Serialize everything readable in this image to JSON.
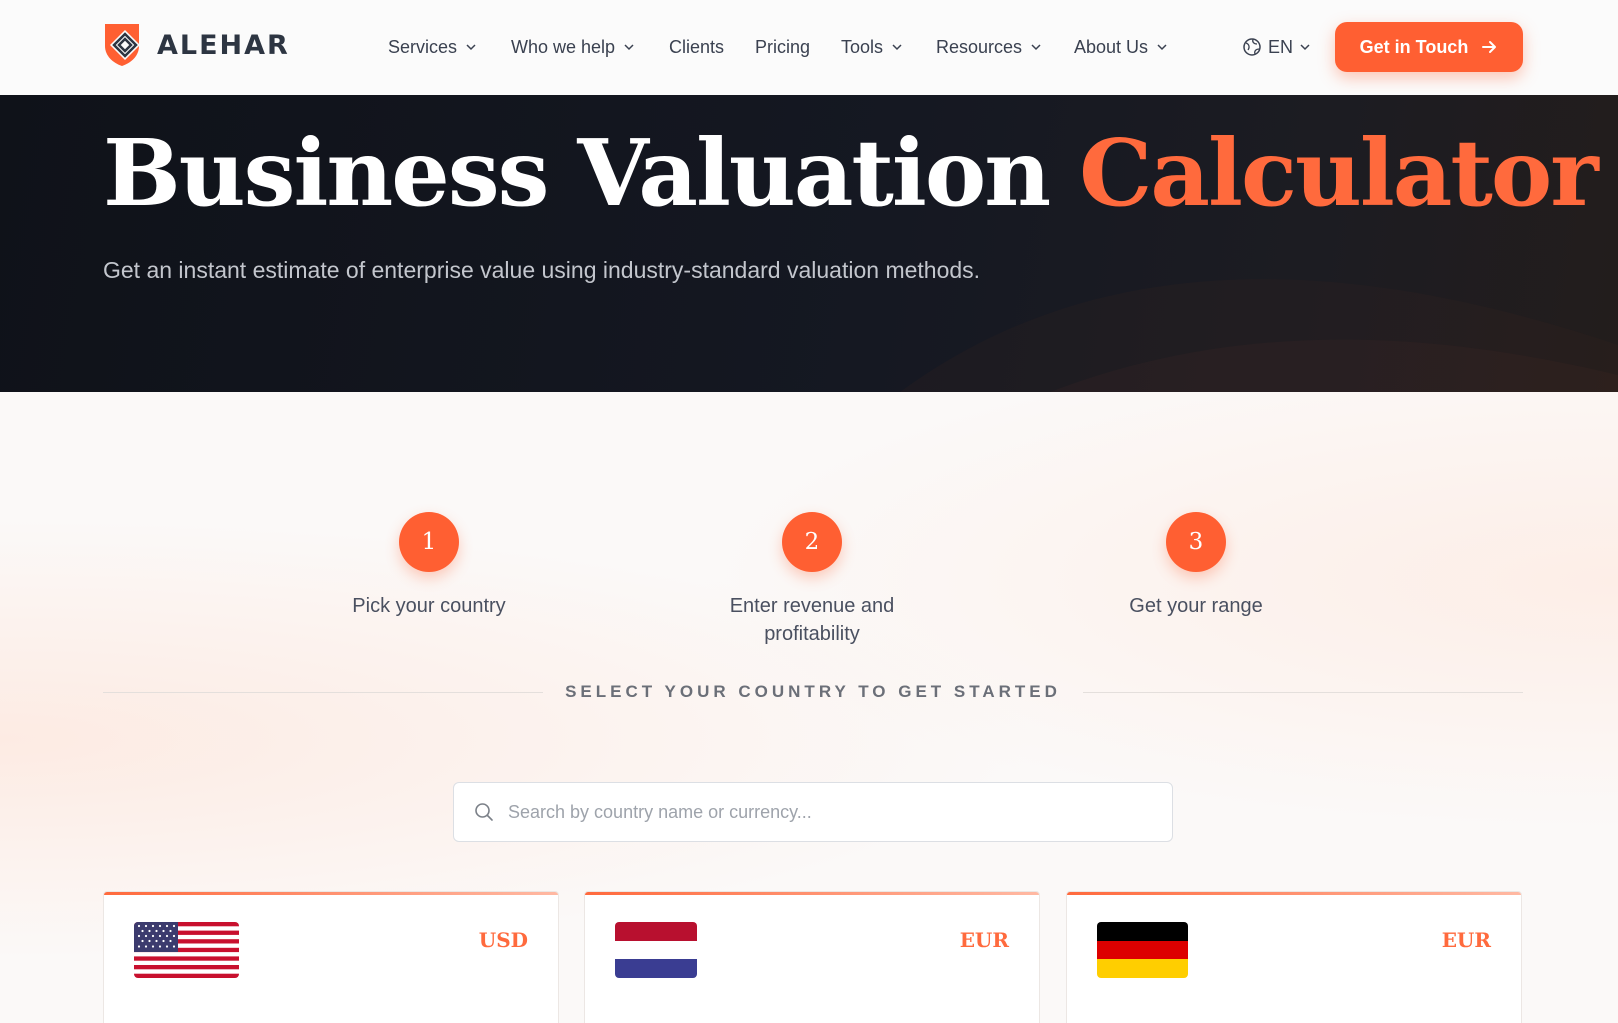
{
  "brand": {
    "name": "ALEHAR"
  },
  "nav": {
    "items": [
      {
        "label": "Services",
        "dropdown": true
      },
      {
        "label": "Who we help",
        "dropdown": true
      },
      {
        "label": "Clients",
        "dropdown": false
      },
      {
        "label": "Pricing",
        "dropdown": false
      },
      {
        "label": "Tools",
        "dropdown": true
      },
      {
        "label": "Resources",
        "dropdown": true
      },
      {
        "label": "About Us",
        "dropdown": true
      }
    ],
    "language": "EN",
    "cta_label": "Get in Touch"
  },
  "hero": {
    "title_main": "Business Valuation",
    "title_accent": "Calculator",
    "subtitle": "Get an instant estimate of enterprise value using industry-standard valuation methods."
  },
  "steps": [
    {
      "number": "1",
      "label": "Pick your country"
    },
    {
      "number": "2",
      "label": "Enter revenue and profitability"
    },
    {
      "number": "3",
      "label": "Get your range"
    }
  ],
  "country_section": {
    "heading": "SELECT YOUR COUNTRY TO GET STARTED",
    "search_placeholder": "Search by country name or currency...",
    "cards": [
      {
        "flag": "us-flag",
        "currency": "USD"
      },
      {
        "flag": "netherlands-flag",
        "currency": "EUR"
      },
      {
        "flag": "germany-flag",
        "currency": "EUR"
      }
    ]
  },
  "colors": {
    "accent": "#ff5f32",
    "hero_bg": "#12151d",
    "text_dark": "#2d3542"
  }
}
